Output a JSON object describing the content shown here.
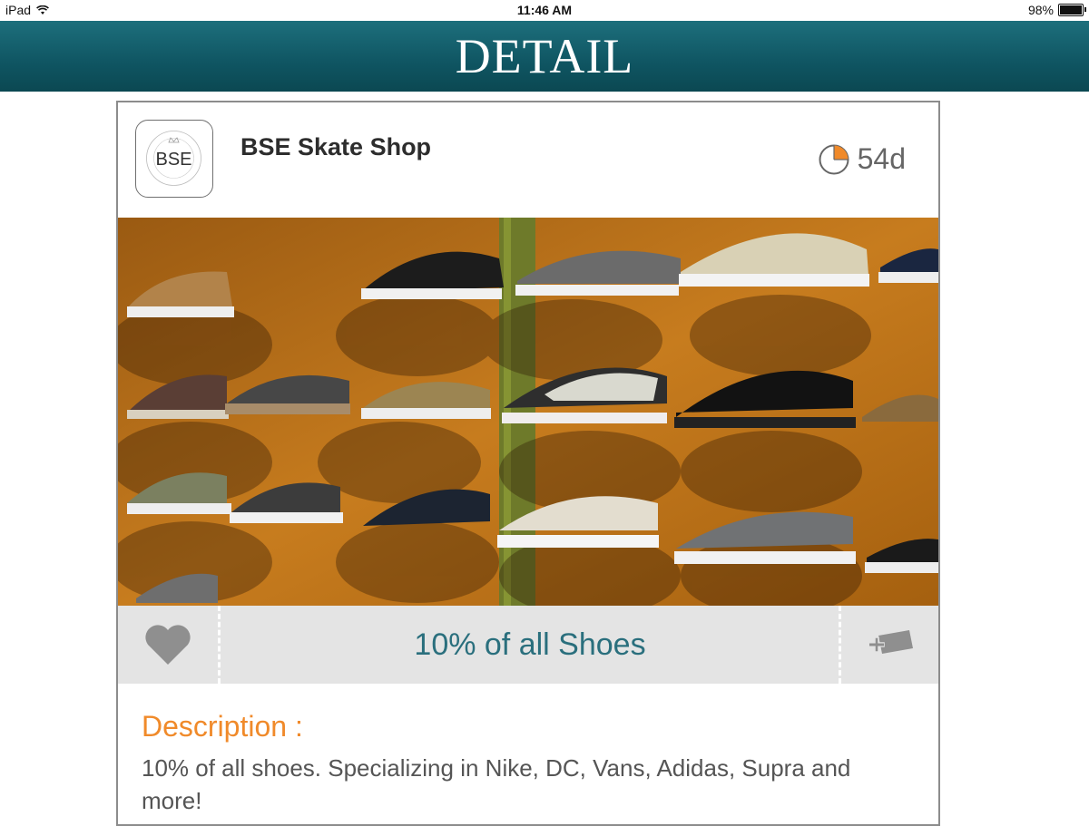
{
  "status_bar": {
    "device": "iPad",
    "time": "11:46 AM",
    "battery_text": "98%",
    "battery_level": 0.98
  },
  "nav": {
    "title": "DETAIL"
  },
  "card": {
    "shop_name": "BSE Skate Shop",
    "logo_text": "BSE",
    "logo_ring_text": "BSE EST 1997 BSE EST 1997",
    "timer_icon": "pie-timer-icon",
    "timer_value": "54d",
    "photo_icon": "shoe-wall-photo",
    "offer_title": "10% of all Shoes",
    "favorite_icon": "heart-icon",
    "add_icon": "add-card-icon",
    "description_label": "Description :",
    "description_text": "10% of all shoes. Specializing in Nike, DC, Vans, Adidas, Supra and more!"
  },
  "colors": {
    "nav_bg": "#0f5562",
    "accent_orange": "#f08a2a",
    "offer_teal": "#2a6f7d",
    "action_bar_bg": "#e4e4e4"
  }
}
